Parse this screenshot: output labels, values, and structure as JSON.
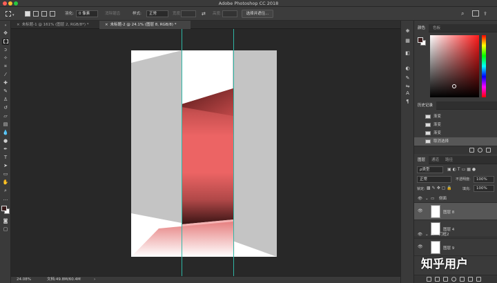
{
  "window": {
    "title": "Adobe Photoshop CC 2018",
    "traffic_colors": [
      "#fd5f57",
      "#febc2e",
      "#28c840"
    ]
  },
  "options_bar": {
    "feather_label": "羽化:",
    "feather_value": "0 像素",
    "antialias_label": "消除锯齿",
    "style_label": "样式:",
    "style_value": "正常",
    "width_label": "宽度:",
    "height_label": "高度:",
    "select_mask_label": "选择并遮住..."
  },
  "tabs": [
    {
      "label": "未标题-1 @ 161% (图层 2, RGB/8*) *",
      "active": false
    },
    {
      "label": "未标题-2 @ 24.1% (图层 8, RGB/8) *",
      "active": true
    }
  ],
  "status": {
    "zoom": "24.08%",
    "doc_info": "文档:49.8M/60.4M"
  },
  "panels": {
    "color_tabs": [
      "颜色",
      "色板"
    ],
    "history_tab": "历史记录",
    "history_items": [
      {
        "label": "渐变",
        "selected": false
      },
      {
        "label": "渐变",
        "selected": false
      },
      {
        "label": "渐变",
        "selected": false
      },
      {
        "label": "取消选择",
        "selected": true
      }
    ],
    "layers_tabs": [
      "图层",
      "通道",
      "路径"
    ],
    "kind_label": "ρ类型",
    "blend_mode": "正常",
    "opacity_label": "不透明度:",
    "opacity_value": "100%",
    "lock_label": "锁定:",
    "fill_label": "填充:",
    "fill_value": "100%",
    "groups": [
      {
        "name": "侧面"
      },
      {
        "name": "门框2"
      }
    ],
    "layers": [
      {
        "name": "图层 8",
        "selected": true
      },
      {
        "name": "图层 4",
        "selected": false
      },
      {
        "name": "图层 9",
        "selected": false
      }
    ]
  },
  "watermark": "知乎用户",
  "colors": {
    "canvas_bg": "#282828",
    "panel_bg": "#3a3a3a",
    "guide": "#2fb7a6",
    "door_red": "#ec6464",
    "wall_grey": "#c4c4c4"
  }
}
